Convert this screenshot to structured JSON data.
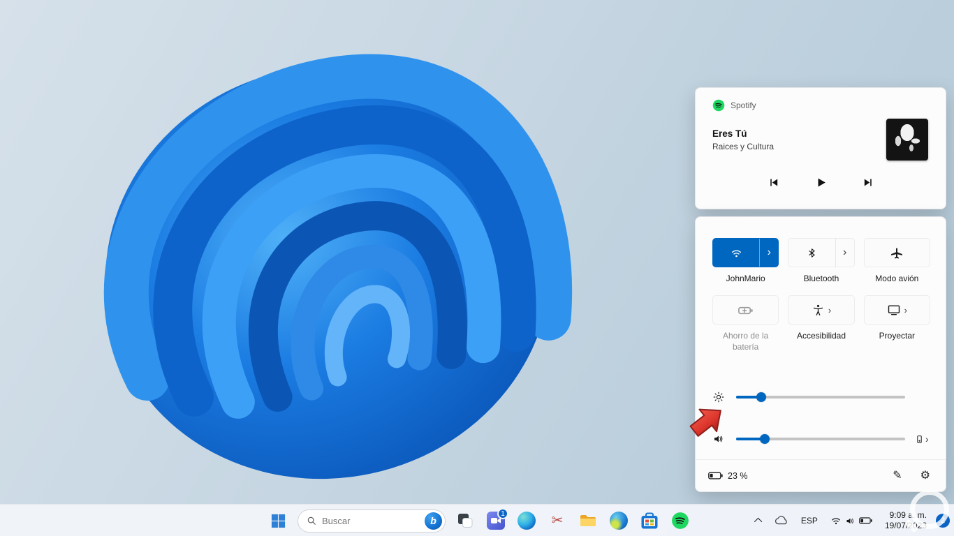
{
  "glyphs": {
    "chevron_right": "›",
    "gear": "⚙",
    "pencil": "✎",
    "scissors": "✂",
    "bing": "b"
  },
  "media_flyout": {
    "app_name": "Spotify",
    "track_title": "Eres Tú",
    "track_artist": "Raices y Cultura"
  },
  "quick_settings": {
    "wifi_label": "JohnMario",
    "bluetooth_label": "Bluetooth",
    "airplane_label": "Modo avión",
    "battery_saver_label": "Ahorro de la batería",
    "accessibility_label": "Accesibilidad",
    "project_label": "Proyectar",
    "brightness_percent": 15,
    "volume_percent": 17,
    "battery_status": "23 %"
  },
  "taskbar": {
    "search_placeholder": "Buscar",
    "chat_badge": "1",
    "language": "ESP",
    "time": "9:09 a. m.",
    "date": "19/07/2023",
    "notification_count": "2"
  }
}
